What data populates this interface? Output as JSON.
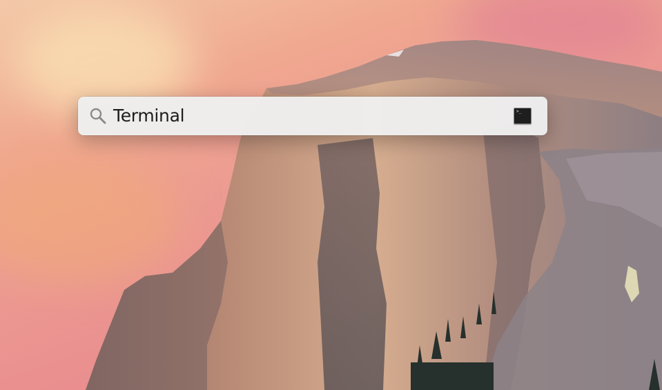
{
  "spotlight": {
    "query": "Terminal",
    "search_icon": "magnifying-glass-icon",
    "result_icon": "terminal-app-icon",
    "result_icon_prompt": ">_"
  },
  "colors": {
    "sky_top": "#f3c8a8",
    "sky_pink": "#ec9a92",
    "rock_light": "#c9a08a",
    "rock_shadow": "#5d5558",
    "search_bar": "#eeeeee",
    "query_text": "#1c1c1c"
  }
}
